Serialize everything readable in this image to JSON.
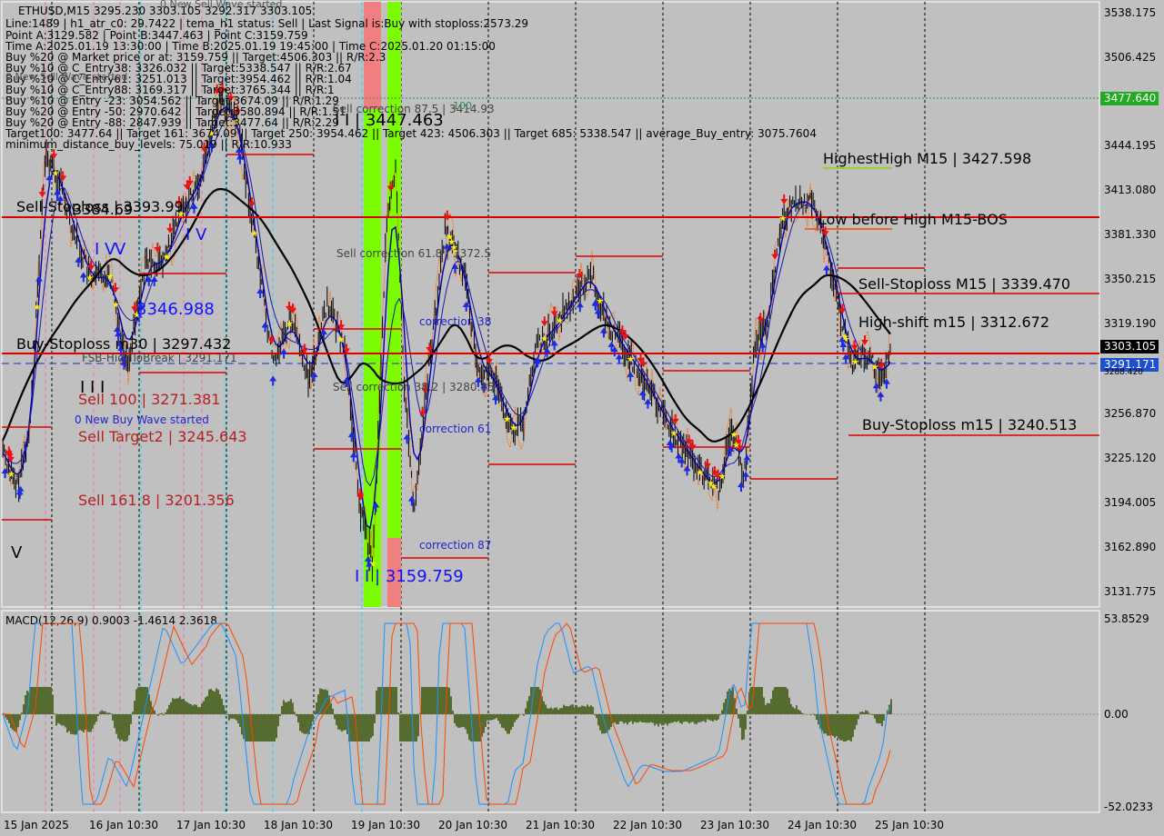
{
  "header": {
    "symbol_line": "ETHUSD,M15  3295.230 3303.105 3292.317 3303.105",
    "status_line": "Line:1489 | h1_atr_c0: 29.7422 | tema_h1 status: Sell | Last Signal is:Buy with stoploss:2573.29",
    "points_line": "Point A:3129.582 | Point B:3447.463 | Point C:3159.759",
    "times_line": "Time A:2025.01.19 13:30:00 | Time B:2025.01.19 19:45:00 | Time C:2025.01.20 01:15:00",
    "buy_lines": [
      "Buy %20 @ Market price or at: 3159.759 || Target:4506.303 || R/R:2.3",
      "Buy %10 @ C_Entry38: 3326.032 || Target:5338.547 || R/R:2.67",
      "Buy %10 @ C_Entry61: 3251.013 || Target:3954.462 || R/R:1.04",
      "Buy %10 @ C_Entry88: 3169.317 || Target:3765.344 || R/R:1",
      "Buy %10 @ Entry -23: 3054.562 || Target:3674.09 || R/R:1.29",
      "Buy %20 @ Entry -50: 2970.642 || Target:3580.894 || R/R:1.51",
      "Buy %20 @ Entry -88: 2847.939 || Target:3477.64 || R/R:2.29"
    ],
    "targets_line": "Target100: 3477.64 || Target 161: 3674.09 || Target 250: 3954.462 || Target 423: 4506.303 || Target 685: 5338.547 || average_Buy_entry: 3075.7604",
    "min_distance_line": "minimum_distance_buy_levels: 75.019 || R/R:10.933",
    "overlay_wave_a": "0 New Sell Wave started",
    "overlay_wave_b": "0 New Sell Wave started"
  },
  "annotations": {
    "high_label": "I I | 3447.463",
    "low_label": "I I | 3159.759",
    "highest_high": "HighestHigh   M15 | 3427.598",
    "low_before_high": "Low before High   M15-BOS",
    "sell_stoploss_m15": "Sell-Stoploss M15 | 3339.470",
    "high_shift": "High-shift m15 | 3312.672",
    "buy_stoploss_m15": "Buy-Stoploss m15 | 3240.513",
    "sell_stoploss_left": "Sell-Stoploss | 3393.99",
    "sell_stoploss_left_b": "3384.69",
    "buy_stoploss_left": "Buy-Stoploss m30 | 3297.432",
    "fsb_high": "FSB-HighToBreak | 3291.171",
    "sell_100": "Sell 100 | 3271.381",
    "new_buy_wave": "0 New Buy Wave started",
    "sell_target2": "Sell Target2 | 3245.643",
    "sell_161": "Sell 161.8 | 3201.356",
    "blue_3346": "3346.988",
    "sell_corr_875": "Sell correction 87.5 | 3414.93",
    "sell_corr_618": "Sell correction 61.8 | 3372.5",
    "sell_corr_382": "Sell correction 38.2 | 3280.85",
    "correction_38": "correction 38",
    "correction_61": "correction 61",
    "correction_87": "correction 87",
    "label_100": "100",
    "wave_iv": "I V",
    "wave_iv2": "I V",
    "wave_v": "V",
    "wave_iii": "I I I",
    "wave_small_v": "V"
  },
  "price_axis": {
    "ticks": [
      "3538.175",
      "3506.425",
      "3475.675",
      "3444.195",
      "3413.080",
      "3381.330",
      "3350.215",
      "3319.190",
      "3287.440",
      "3256.870",
      "3225.120",
      "3194.005",
      "3162.890",
      "3131.775"
    ],
    "current_price": "3303.105",
    "level_green": "3477.640",
    "level_blue": "3291.171",
    "tick_3288": "3288.420"
  },
  "macd": {
    "label": "MACD(12,26,9) 0.9003 -1.4614 2.3618",
    "ticks": [
      "53.8529",
      "0.00",
      "-52.0233"
    ]
  },
  "time_axis": [
    "15 Jan 2025",
    "16 Jan 10:30",
    "17 Jan 10:30",
    "18 Jan 10:30",
    "19 Jan 10:30",
    "20 Jan 10:30",
    "21 Jan 10:30",
    "22 Jan 10:30",
    "23 Jan 10:30",
    "24 Jan 10:30",
    "25 Jan 10:30"
  ],
  "colors": {
    "background": "#c0c0c0",
    "sell_red": "#ff0000",
    "ma_black": "#000000",
    "ma_blue": "#0000aa",
    "zone_green": "#7cfc00",
    "zone_red": "#f08080",
    "macd_hist": "#556b2f",
    "current_price_bg": "#000000",
    "level_green_bg": "#22aa22",
    "level_blue_bg": "#1e4fd0"
  },
  "chart_data": {
    "type": "line",
    "title": "ETHUSD,M15",
    "ohlc_last": {
      "open": 3295.23,
      "high": 3303.105,
      "low": 3292.317,
      "close": 3303.105
    },
    "x": [
      "15 Jan 2025",
      "16 Jan 10:30",
      "17 Jan 10:30",
      "18 Jan 10:30",
      "19 Jan 10:30",
      "20 Jan 10:30",
      "21 Jan 10:30",
      "22 Jan 10:30",
      "23 Jan 10:30",
      "24 Jan 10:30",
      "25 Jan 10:30"
    ],
    "ylim": [
      3120,
      3545
    ],
    "series": [
      {
        "name": "",
        "values": [
          3200,
          3330,
          3360,
          3320,
          3165,
          3305,
          3325,
          3290,
          3265,
          3400,
          3298
        ]
      }
    ],
    "levels": [
      {
        "name": "Sell-Stoploss",
        "value": 3393.99
      },
      {
        "name": "Buy-Stoploss m30",
        "value": 3297.432
      },
      {
        "name": "FSB-HighToBreak",
        "value": 3291.171
      },
      {
        "name": "Sell-Stoploss M15",
        "value": 3339.47
      },
      {
        "name": "Buy-Stoploss m15",
        "value": 3240.513
      },
      {
        "name": "Target100",
        "value": 3477.64
      }
    ],
    "macd": {
      "fast": 12,
      "slow": 26,
      "signal": 9,
      "values": [
        0.9003,
        -1.4614,
        2.3618
      ],
      "ylim": [
        -52.0233,
        53.8529
      ]
    }
  }
}
